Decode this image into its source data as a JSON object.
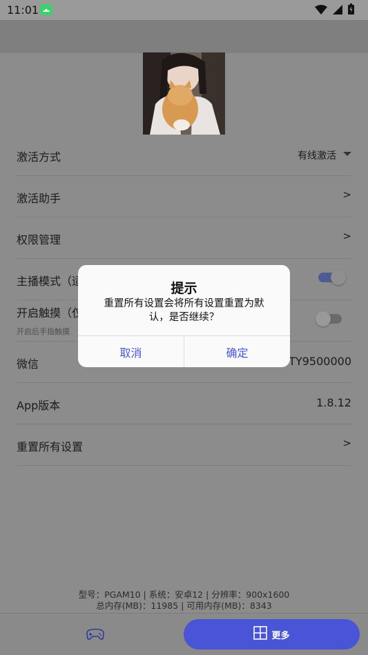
{
  "status_bar": {
    "time": "11:01",
    "icons": [
      "android-icon",
      "wifi-icon",
      "signal-icon",
      "battery-icon"
    ]
  },
  "settings": {
    "activation_mode": {
      "label": "激活方式",
      "value": "有线激活"
    },
    "activation_helper": {
      "label": "激活助手",
      "chevron": ">"
    },
    "permissions": {
      "label": "权限管理",
      "chevron": ">"
    },
    "streamer_mode": {
      "label": "主播模式（适",
      "enabled": true
    },
    "touch_mode": {
      "label": "开启触摸（仅",
      "subtext": "开启后手指触摸",
      "enabled": false
    },
    "wechat": {
      "label": "微信",
      "value": "TY9500000"
    },
    "app_version": {
      "label": "App版本",
      "value": "1.8.12"
    },
    "reset_all": {
      "label": "重置所有设置",
      "chevron": ">"
    }
  },
  "device_info": {
    "line1": "型号：PGAM10 | 系统：安卓12 | 分辨率：900x1600",
    "line2": "总内存(MB)：11985 | 可用内存(MB)：8343"
  },
  "bottom_bar": {
    "more_label": "更多"
  },
  "dialog": {
    "title": "提示",
    "message": "重置所有设置会将所有设置重置为默认，是否继续？",
    "cancel_label": "取消",
    "confirm_label": "确定"
  },
  "colors": {
    "accent": "#4a54d6",
    "scrim": "#8c8c8c",
    "dialog_bg": "#fafafa"
  }
}
